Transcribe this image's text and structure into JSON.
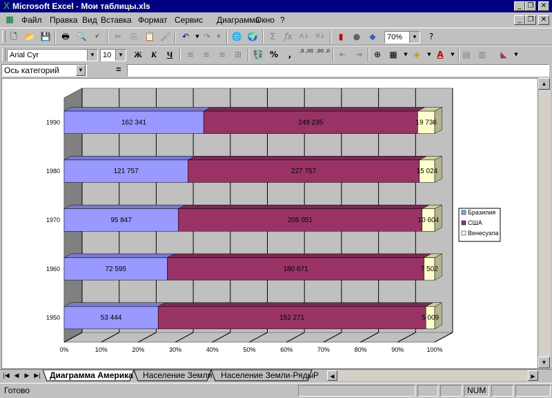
{
  "window": {
    "title": "Microsoft Excel - Мои таблицы.xls"
  },
  "menu": {
    "items": [
      "Файл",
      "Правка",
      "Вид",
      "Вставка",
      "Формат",
      "Сервис",
      "Диаграмма",
      "Окно",
      "?"
    ]
  },
  "toolbar": {
    "zoom": "70%",
    "font": "Arial Cyr",
    "size": "10",
    "bold_label": "Ж",
    "italic_label": "К",
    "underline_label": "Ч",
    "percent_label": "%",
    "comma_label": ",",
    "inc_decimal_label": ",0 ,00",
    "dec_decimal_label": ",00 ,0"
  },
  "formula_bar": {
    "name_box": "Ось категорий",
    "equals": "="
  },
  "chart_data": {
    "type": "bar",
    "stacking": "percent",
    "orientation": "horizontal",
    "style": "3d",
    "categories": [
      "1950",
      "1960",
      "1970",
      "1980",
      "1990"
    ],
    "series": [
      {
        "name": "Бразилия",
        "color": "#9999ff",
        "values": [
          53444,
          72595,
          95847,
          121757,
          162341
        ],
        "labels": [
          "53 444",
          "72 595",
          "95 847",
          "121 757",
          "162 341"
        ]
      },
      {
        "name": "США",
        "color": "#993366",
        "values": [
          152271,
          180671,
          205051,
          227757,
          249235
        ],
        "labels": [
          "152 271",
          "180 671",
          "205 051",
          "227 757",
          "249 235"
        ]
      },
      {
        "name": "Венесуэла",
        "color": "#ffffcc",
        "values": [
          5009,
          7502,
          10604,
          15024,
          19736
        ],
        "labels": [
          "5 009",
          "7 502",
          "10 604",
          "15 024",
          "19 736"
        ]
      }
    ],
    "x_ticks": [
      "0%",
      "10%",
      "20%",
      "30%",
      "40%",
      "50%",
      "60%",
      "70%",
      "80%",
      "90%",
      "100%"
    ],
    "xlim": [
      0,
      100
    ],
    "grid": true,
    "legend": "right"
  },
  "tabs": {
    "items": [
      "Диаграмма Америка",
      "Население Земли",
      "Население Земли-Ряды",
      "Р"
    ],
    "active": 0
  },
  "status": {
    "ready": "Готово",
    "num": "NUM"
  }
}
